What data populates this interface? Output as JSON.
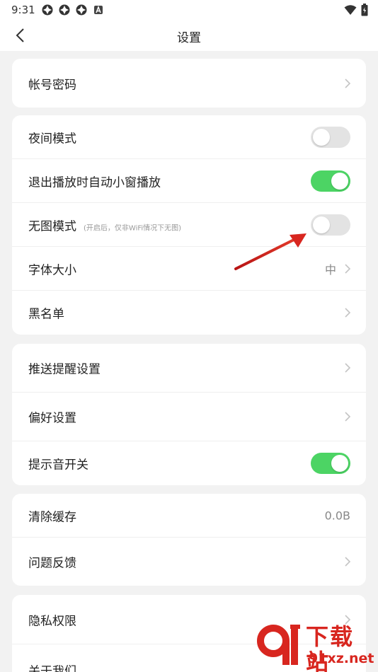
{
  "status_bar": {
    "time": "9:31",
    "left_icons": [
      "vpn-icon",
      "vpn-icon",
      "vpn-icon",
      "app-a-icon"
    ],
    "right_icons": [
      "wifi-icon",
      "battery-icon"
    ]
  },
  "header": {
    "title": "设置",
    "back_icon": "chevron-left-icon"
  },
  "sections": {
    "account": {
      "account_password": "帐号密码"
    },
    "display": {
      "night_mode": "夜间模式",
      "auto_mini_window": "退出播放时自动小窗播放",
      "no_image_mode": "无图模式",
      "no_image_note": "(开启后，仅非WiFi情况下无图)",
      "font_size": "字体大小",
      "font_size_value": "中",
      "blacklist": "黑名单"
    },
    "notify": {
      "push_settings": "推送提醒设置",
      "preferences": "偏好设置",
      "sound_switch": "提示音开关"
    },
    "storage": {
      "clear_cache": "清除缓存",
      "cache_size": "0.0B",
      "feedback": "问题反馈"
    },
    "about": {
      "privacy": "隐私权限",
      "about_us": "关于我们"
    }
  },
  "toggles": {
    "night_mode": false,
    "auto_mini_window": true,
    "no_image_mode": false,
    "sound_switch": true
  },
  "colors": {
    "accent_green": "#4cd464",
    "annotation_red": "#d8261f",
    "background": "#f2f2f2"
  },
  "watermark": {
    "brand": "下载站",
    "url": "91xz.net"
  }
}
